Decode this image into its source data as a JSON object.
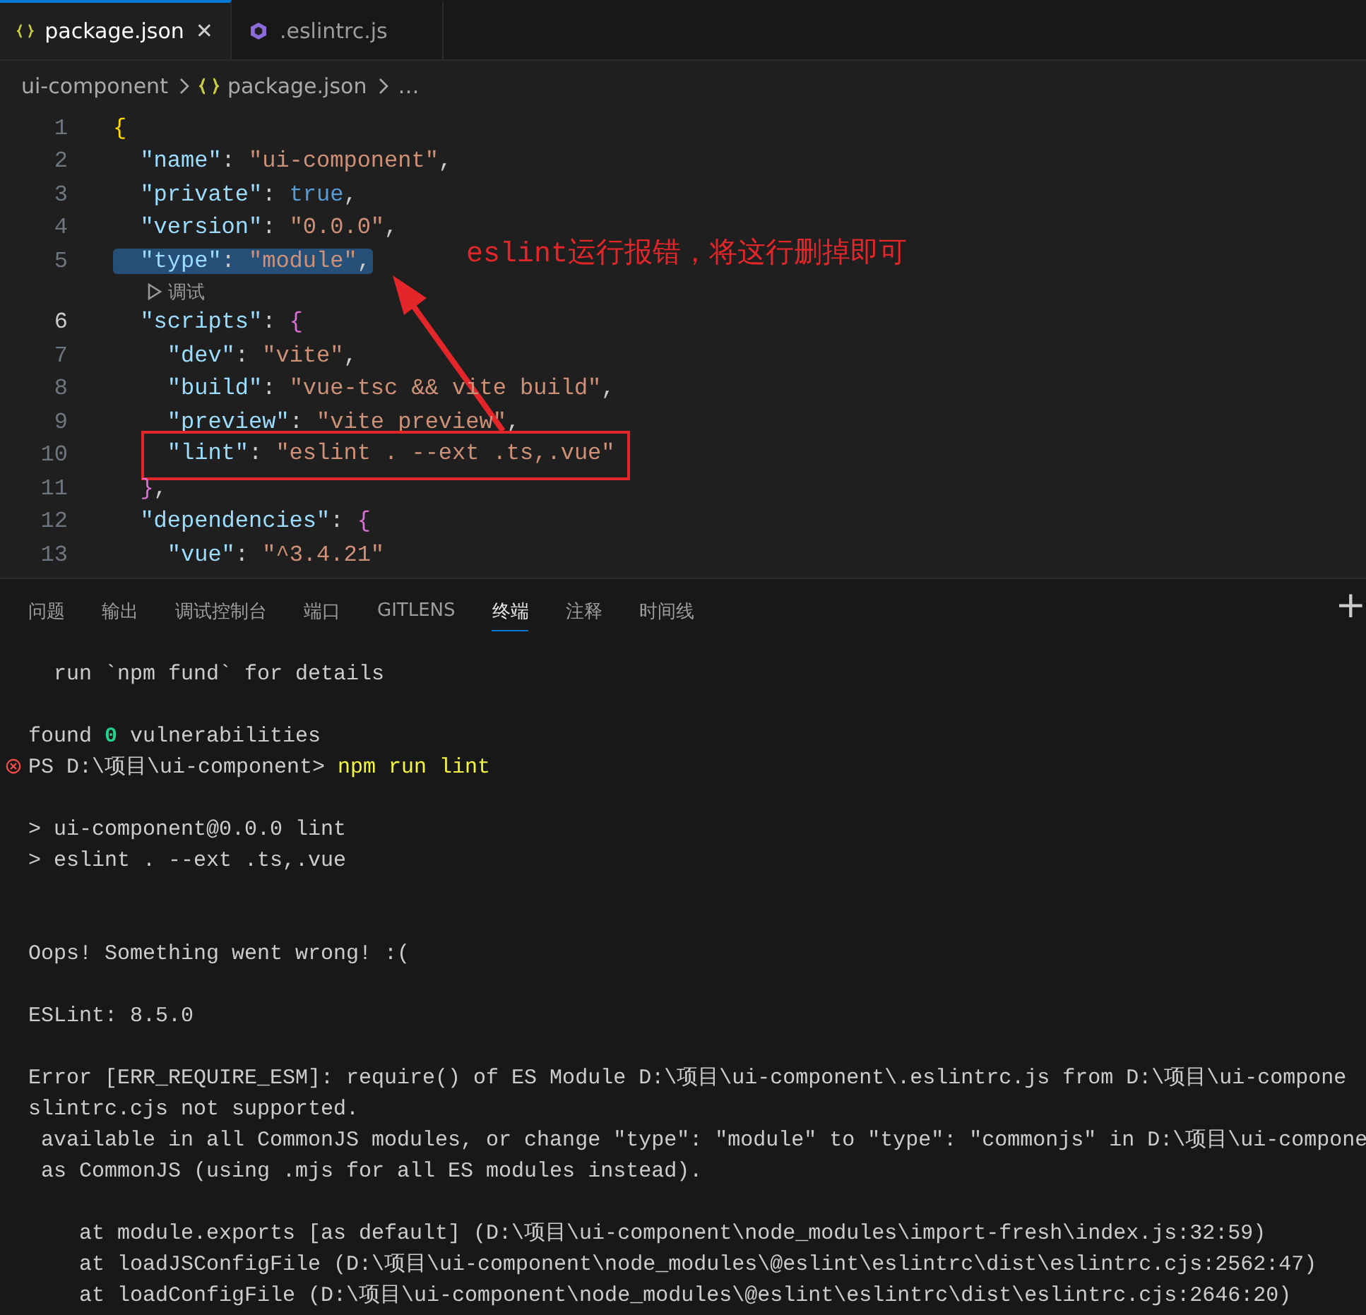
{
  "tabs": [
    {
      "label": "package.json",
      "selected": true,
      "close": "✕"
    },
    {
      "label": ".eslintrc.js",
      "selected": false
    }
  ],
  "breadcrumb": [
    {
      "label": "ui-component",
      "kind": "folder"
    },
    {
      "label": "package.json",
      "kind": "file"
    },
    {
      "label": "…",
      "kind": "more"
    }
  ],
  "editor": {
    "lines": [
      {
        "number": "1",
        "current": false,
        "selected": false,
        "tokens": [
          {
            "kind": "bracket",
            "text": "{"
          }
        ],
        "children": [
          {
            "number": "2",
            "current": false,
            "selected": false,
            "tokens": [
              {
                "kind": "key",
                "text": "\"name\""
              },
              {
                "kind": "punct",
                "text": ": "
              },
              {
                "kind": "string",
                "text": "\"ui-component\""
              },
              {
                "kind": "punct",
                "text": ","
              }
            ]
          },
          {
            "number": "3",
            "current": false,
            "selected": false,
            "tokens": [
              {
                "kind": "key",
                "text": "\"private\""
              },
              {
                "kind": "punct",
                "text": ": "
              },
              {
                "kind": "keyword",
                "text": "true"
              },
              {
                "kind": "punct",
                "text": ","
              }
            ]
          },
          {
            "number": "4",
            "current": false,
            "selected": false,
            "tokens": [
              {
                "kind": "key",
                "text": "\"version\""
              },
              {
                "kind": "punct",
                "text": ": "
              },
              {
                "kind": "string",
                "text": "\"0.0.0\""
              },
              {
                "kind": "punct",
                "text": ","
              }
            ]
          },
          {
            "number": "5",
            "current": false,
            "selected": true,
            "tokens": [
              {
                "kind": "key",
                "text": "\"type\""
              },
              {
                "kind": "punct",
                "text": ": "
              },
              {
                "kind": "string",
                "text": "\"module\""
              },
              {
                "kind": "punct",
                "text": ","
              }
            ],
            "codelens": "调试"
          },
          {
            "number": "6",
            "current": true,
            "selected": false,
            "tokens": [
              {
                "kind": "key",
                "text": "\"scripts\""
              },
              {
                "kind": "punct",
                "text": ": "
              },
              {
                "kind": "bracket",
                "text": "{"
              }
            ],
            "children": [
              {
                "number": "7",
                "current": false,
                "selected": false,
                "tokens": [
                  {
                    "kind": "key",
                    "text": "\"dev\""
                  },
                  {
                    "kind": "punct",
                    "text": ": "
                  },
                  {
                    "kind": "string",
                    "text": "\"vite\""
                  },
                  {
                    "kind": "punct",
                    "text": ","
                  }
                ]
              },
              {
                "number": "8",
                "current": false,
                "selected": false,
                "tokens": [
                  {
                    "kind": "key",
                    "text": "\"build\""
                  },
                  {
                    "kind": "punct",
                    "text": ": "
                  },
                  {
                    "kind": "string",
                    "text": "\"vue-tsc && vite build\""
                  },
                  {
                    "kind": "punct",
                    "text": ","
                  }
                ]
              },
              {
                "number": "9",
                "current": false,
                "selected": false,
                "tokens": [
                  {
                    "kind": "key",
                    "text": "\"preview\""
                  },
                  {
                    "kind": "punct",
                    "text": ": "
                  },
                  {
                    "kind": "string",
                    "text": "\"vite preview\""
                  },
                  {
                    "kind": "punct",
                    "text": ","
                  }
                ]
              },
              {
                "number": "10",
                "current": false,
                "selected": false,
                "tokens": [
                  {
                    "kind": "key",
                    "text": "\"lint\""
                  },
                  {
                    "kind": "punct",
                    "text": ": "
                  },
                  {
                    "kind": "string",
                    "text": "\"eslint . --ext .ts,.vue\""
                  }
                ],
                "boxed": true
              }
            ]
          },
          {
            "number": "11",
            "current": false,
            "selected": false,
            "tokens": [
              {
                "kind": "bracket",
                "text": "}"
              },
              {
                "kind": "punct",
                "text": ","
              }
            ]
          },
          {
            "number": "12",
            "current": false,
            "selected": false,
            "tokens": [
              {
                "kind": "key",
                "text": "\"dependencies\""
              },
              {
                "kind": "punct",
                "text": ": "
              },
              {
                "kind": "bracket",
                "text": "{"
              }
            ],
            "children": [
              {
                "number": "13",
                "current": false,
                "selected": false,
                "tokens": [
                  {
                    "kind": "key",
                    "text": "\"vue\""
                  },
                  {
                    "kind": "punct",
                    "text": ": "
                  },
                  {
                    "kind": "string",
                    "text": "\"^3.4.21\""
                  }
                ]
              }
            ]
          }
        ]
      }
    ]
  },
  "annotation": {
    "text": "eslint运行报错，将这行删掉即可"
  },
  "panel_tabs": [
    {
      "label": "问题",
      "selected": false
    },
    {
      "label": "输出",
      "selected": false
    },
    {
      "label": "调试控制台",
      "selected": false
    },
    {
      "label": "端口",
      "selected": false
    },
    {
      "label": "GITLENS",
      "selected": false
    },
    {
      "label": "终端",
      "selected": true
    },
    {
      "label": "注释",
      "selected": false
    },
    {
      "label": "时间线",
      "selected": false
    }
  ],
  "panel_add": "+",
  "terminal": [
    {
      "kind": "plain",
      "segments": [
        {
          "kind": "text",
          "text": "  run `npm fund` for details"
        }
      ]
    },
    {
      "kind": "blank"
    },
    {
      "kind": "plain",
      "segments": [
        {
          "kind": "text",
          "text": "found "
        },
        {
          "kind": "success",
          "text": "0"
        },
        {
          "kind": "text",
          "text": " vulnerabilities"
        }
      ]
    },
    {
      "kind": "error",
      "segments": [
        {
          "kind": "text",
          "text": "PS D:\\项目\\ui-component> "
        },
        {
          "kind": "command",
          "text": "npm run lint"
        }
      ]
    },
    {
      "kind": "blank"
    },
    {
      "kind": "plain",
      "segments": [
        {
          "kind": "text",
          "text": "> ui-component@0.0.0 lint"
        }
      ]
    },
    {
      "kind": "plain",
      "segments": [
        {
          "kind": "text",
          "text": "> eslint . --ext .ts,.vue"
        }
      ]
    },
    {
      "kind": "blank"
    },
    {
      "kind": "blank"
    },
    {
      "kind": "plain",
      "segments": [
        {
          "kind": "text",
          "text": "Oops! Something went wrong! :("
        }
      ]
    },
    {
      "kind": "blank"
    },
    {
      "kind": "plain",
      "segments": [
        {
          "kind": "text",
          "text": "ESLint: 8.5.0"
        }
      ]
    },
    {
      "kind": "blank"
    },
    {
      "kind": "plain",
      "segments": [
        {
          "kind": "text",
          "text": "Error [ERR_REQUIRE_ESM]: require() of ES Module D:\\项目\\ui-component\\.eslintrc.js from D:\\项目\\ui-compone"
        }
      ]
    },
    {
      "kind": "plain",
      "segments": [
        {
          "kind": "text",
          "text": "slintrc.cjs not supported."
        }
      ]
    },
    {
      "kind": "plain",
      "segments": [
        {
          "kind": "text",
          "text": " available in all CommonJS modules, or change \"type\": \"module\" to \"type\": \"commonjs\" in D:\\项目\\ui-compone"
        }
      ]
    },
    {
      "kind": "plain",
      "segments": [
        {
          "kind": "text",
          "text": " as CommonJS (using .mjs for all ES modules instead)."
        }
      ]
    },
    {
      "kind": "blank"
    },
    {
      "kind": "plain",
      "segments": [
        {
          "kind": "text",
          "text": "    at module.exports [as default] (D:\\项目\\ui-component\\node_modules\\import-fresh\\index.js:32:59)"
        }
      ]
    },
    {
      "kind": "plain",
      "segments": [
        {
          "kind": "text",
          "text": "    at loadJSConfigFile (D:\\项目\\ui-component\\node_modules\\@eslint\\eslintrc\\dist\\eslintrc.cjs:2562:47)"
        }
      ]
    },
    {
      "kind": "plain",
      "segments": [
        {
          "kind": "text",
          "text": "    at loadConfigFile (D:\\项目\\ui-component\\node_modules\\@eslint\\eslintrc\\dist\\eslintrc.cjs:2646:20)"
        }
      ]
    }
  ]
}
